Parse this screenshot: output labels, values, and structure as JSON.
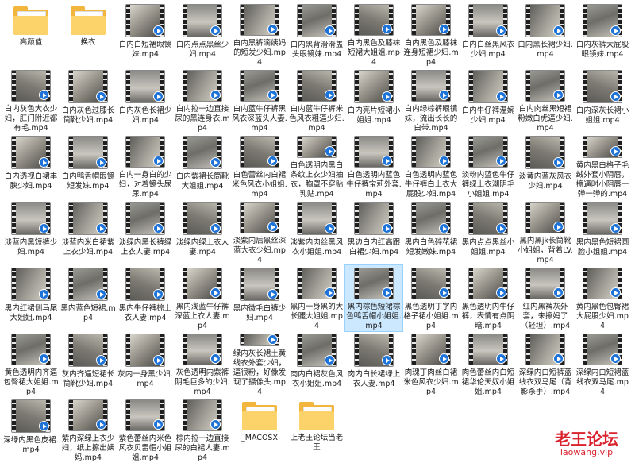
{
  "items": [
    {
      "type": "folder",
      "label": "高颜值"
    },
    {
      "type": "folder",
      "label": "换衣"
    },
    {
      "type": "video",
      "label": "白内白短裙眼镜妹.mp4"
    },
    {
      "type": "video",
      "label": "白内点点黑丝少妇.mp4"
    },
    {
      "type": "video",
      "label": "白内黑裤滴姨妈的短发少妇.mp4"
    },
    {
      "type": "video",
      "label": "白内黑背滑滑盖头眼镜妹.mp4"
    },
    {
      "type": "video",
      "label": "白内黑色及膝袜短裙大姐姐.mp4"
    },
    {
      "type": "video",
      "label": "白内黑色及膝袜连身短裙少妇.mp4"
    },
    {
      "type": "video",
      "label": "白内白丝黑风衣少妇.mp4"
    },
    {
      "type": "video",
      "label": "白内黑长裙少妇.mp4"
    },
    {
      "type": "video",
      "label": "白内灰裤大屁股眼镜妹.mp4"
    },
    {
      "type": "video",
      "label": "白内灰色大衣少妇，肛门附近都有毛.mp4"
    },
    {
      "type": "video",
      "label": "白内灰色过膝长筒靴少妇.mp4"
    },
    {
      "type": "video",
      "label": "白内灰色长裙少妇.mp4"
    },
    {
      "type": "video",
      "label": "白内拉一边直接尿的黑连身衣.mp4"
    },
    {
      "type": "video",
      "label": "白内蓝牛仔裤黑风衣深蓝头人妻.mp4"
    },
    {
      "type": "video",
      "label": "白内蓝牛仔裤米色风衣粗逼少妇.mp4"
    },
    {
      "type": "video",
      "label": "白内亮片短裙小姐姐.mp4"
    },
    {
      "type": "video",
      "label": "白内绿棕裤眼镜妹，流出长长的白带.mp4"
    },
    {
      "type": "video",
      "label": "白内牛仔裤温婉少妇.mp4"
    },
    {
      "type": "video",
      "label": "白内肉丝黑短裙粉嫩白虎逼少妇.mp4"
    },
    {
      "type": "video",
      "label": "白内深灰长裙小姐姐.mp4"
    },
    {
      "type": "video",
      "label": "白内透视白裙丰腴少妇.mp4"
    },
    {
      "type": "video",
      "label": "白内鸭舌帽眼镜短发妹.mp4"
    },
    {
      "type": "video",
      "label": "白内一身白的少妇，对着镜头尿尿.mp4"
    },
    {
      "type": "video",
      "label": "白内紫裙长筒靴大姐姐.mp4"
    },
    {
      "type": "video",
      "label": "白色蕾丝内白裙米色风衣小姐姐.mp4"
    },
    {
      "type": "video",
      "label": "白色透明内黑白条纹上衣少妇抽衣，胸罩不穿贴乳贴.mp4"
    },
    {
      "type": "video",
      "label": "白色透明内蓝色牛仔裤宝莉外套.mp4"
    },
    {
      "type": "video",
      "label": "白色透明内蓝色牛仔裤白上衣大屁股少妇.mp4"
    },
    {
      "type": "video",
      "label": "淡粉内蓝色牛仔裤绿上衣潮阴毛小姐姐.mp4"
    },
    {
      "type": "video",
      "label": "淡黄内蓝灰风衣少妇.mp4"
    },
    {
      "type": "video",
      "label": "黄内黑白格子毛绒外套小阴唇，擦逼时小阴唇一弹一弹的.mp4"
    },
    {
      "type": "video",
      "label": "淡蓝内黑短裤少妇.mp4"
    },
    {
      "type": "video",
      "label": "淡蓝内米白裙紫上衣少妇.mp4"
    },
    {
      "type": "video",
      "label": "淡绿内黑长裤绿上衣人妻.mp4"
    },
    {
      "type": "video",
      "label": "淡绿内绿上衣人妻.mp4"
    },
    {
      "type": "video",
      "label": "淡紫内后黑丝深蓝大衣少妇.mp4"
    },
    {
      "type": "video",
      "label": "淡紫内肉丝黑风衣小姐姐.mp4"
    },
    {
      "type": "video",
      "label": "黑边白内红高跟白裙少妇.mp4"
    },
    {
      "type": "video",
      "label": "黑内白色碎花裙短发嫩妹.mp4"
    },
    {
      "type": "video",
      "label": "黑内点点黑丝小姐姐.mp4"
    },
    {
      "type": "video",
      "label": "黑内黑jk长筒靴小姐姐，背着LV.mp4"
    },
    {
      "type": "video",
      "label": "黑内黑色短裙圆脸小姐姐.mp4"
    },
    {
      "type": "video",
      "label": "黑内红裙侧马尾大姐姐.mp4"
    },
    {
      "type": "video",
      "label": "黑内蓝色短裙.mp4"
    },
    {
      "type": "video",
      "label": "黑内牛仔裤棕上衣人妻.mp4"
    },
    {
      "type": "video",
      "label": "黑内浅蓝牛仔裤深蓝上衣人妻.mp4"
    },
    {
      "type": "video",
      "label": "黑内微毛白裤少妇.mp4"
    },
    {
      "type": "video",
      "label": "黑内一身黑的大长腿大姐姐.mp4"
    },
    {
      "type": "video",
      "label": "黑内棕色短裙棕色鸭舌帽小姐姐.mp4"
    },
    {
      "type": "video",
      "label": "黑色透明丁字内格子裙小姐姐.mp4"
    },
    {
      "type": "video",
      "label": "黑色透明内牛仔裤，表情有点阴暗.mp4"
    },
    {
      "type": "video",
      "label": "红内黑裤灰外套，未擦妈了（轻坦）.mp4"
    },
    {
      "type": "video",
      "label": "黄内黑色包臀裙大屁股少妇.mp4"
    },
    {
      "type": "video",
      "label": "黄色透明内齐逼包臀裙大姐姐.mp4"
    },
    {
      "type": "video",
      "label": "灰内齐逼短裙长筒靴少妇.mp4"
    },
    {
      "type": "video",
      "label": "灰内一身黑少妇.mp4"
    },
    {
      "type": "video",
      "label": "灰色透明内紫裤阴毛巨多的少妇.mp4"
    },
    {
      "type": "video",
      "label": "绿内灰长裙土黄线衣外套少妇，逼很粉，好像发现了摄像头.mp4"
    },
    {
      "type": "video",
      "label": "肉内白裙灰色风衣小姐姐.mp4"
    },
    {
      "type": "video",
      "label": "肉内白长裙绿上衣人妻.mp4"
    },
    {
      "type": "video",
      "label": "肉瑰丁肉丝白裙米色风衣少妇.mp4"
    },
    {
      "type": "video",
      "label": "肉色蕾丝内白短裙华伦天奴小姐姐.mp4"
    },
    {
      "type": "video",
      "label": "深绿内白短裤蓝线衣双马尾（背影杀手）.mp4"
    },
    {
      "type": "video",
      "label": "深绿内白短裙蓝线衣双马尾.mp4"
    },
    {
      "type": "video",
      "label": "深绿内黑色皮裙.mp4"
    },
    {
      "type": "video",
      "label": "紫内深绿上衣少妇，纸上擦出姨妈.mp4"
    },
    {
      "type": "video",
      "label": "紫色蕾丝内米色风衣贝雷帽小姐姐.mp4"
    },
    {
      "type": "video",
      "label": "棕内拉一边直接尿的白裙人妻.mp4"
    },
    {
      "type": "folder",
      "label": "_MACOSX"
    },
    {
      "type": "folder",
      "label": "上老王论坛当老王"
    }
  ],
  "selected_index": 50,
  "watermark": {
    "line1": "老王论坛",
    "line2": "laowang.vip"
  }
}
